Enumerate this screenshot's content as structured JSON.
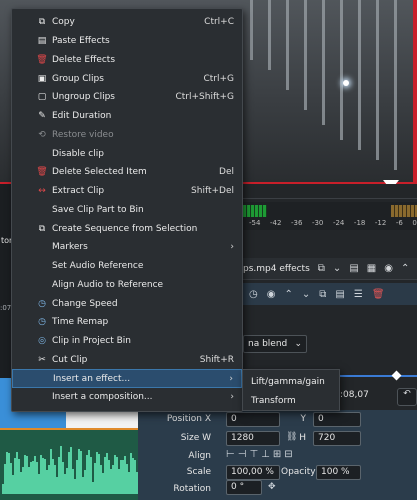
{
  "menu": {
    "items": [
      {
        "icon": "copy-icon",
        "glyph": "⧉",
        "label": "Copy",
        "shortcut": "Ctrl+C"
      },
      {
        "icon": "paste-icon",
        "glyph": "▤",
        "label": "Paste Effects",
        "shortcut": ""
      },
      {
        "icon": "trash-icon",
        "glyph": "🗑",
        "label": "Delete Effects",
        "shortcut": ""
      },
      {
        "icon": "group-icon",
        "glyph": "▣",
        "label": "Group Clips",
        "shortcut": "Ctrl+G"
      },
      {
        "icon": "ungroup-icon",
        "glyph": "▢",
        "label": "Ungroup Clips",
        "shortcut": "Ctrl+Shift+G"
      },
      {
        "icon": "edit-duration-icon",
        "glyph": "✎",
        "label": "Edit Duration",
        "shortcut": ""
      },
      {
        "icon": "restore-icon",
        "glyph": "⟲",
        "label": "Restore video",
        "shortcut": ""
      },
      {
        "icon": "",
        "glyph": "",
        "label": "Disable clip",
        "shortcut": ""
      },
      {
        "icon": "trash-icon",
        "glyph": "🗑",
        "label": "Delete Selected Item",
        "shortcut": "Del"
      },
      {
        "icon": "extract-icon",
        "glyph": "↔",
        "label": "Extract Clip",
        "shortcut": "Shift+Del"
      },
      {
        "icon": "",
        "glyph": "",
        "label": "Save Clip Part to Bin",
        "shortcut": ""
      },
      {
        "icon": "sequence-icon",
        "glyph": "⧉",
        "label": "Create Sequence from Selection",
        "shortcut": ""
      },
      {
        "icon": "",
        "glyph": "",
        "label": "Markers",
        "shortcut": "",
        "submenu": true
      },
      {
        "icon": "",
        "glyph": "",
        "label": "Set Audio Reference",
        "shortcut": ""
      },
      {
        "icon": "",
        "glyph": "",
        "label": "Align Audio to Reference",
        "shortcut": ""
      },
      {
        "icon": "speed-icon",
        "glyph": "◷",
        "label": "Change Speed",
        "shortcut": ""
      },
      {
        "icon": "time-remap-icon",
        "glyph": "◷",
        "label": "Time Remap",
        "shortcut": ""
      },
      {
        "icon": "project-bin-icon",
        "glyph": "◎",
        "label": "Clip in Project Bin",
        "shortcut": ""
      },
      {
        "icon": "scissors-icon",
        "glyph": "✂",
        "label": "Cut Clip",
        "shortcut": "Shift+R"
      },
      {
        "icon": "",
        "glyph": "",
        "label": "Insert an effect...",
        "shortcut": "",
        "submenu": true
      },
      {
        "icon": "",
        "glyph": "",
        "label": "Insert a composition...",
        "shortcut": "",
        "submenu": true
      }
    ]
  },
  "submenu": {
    "items": [
      "Lift/gamma/gain",
      "Transform"
    ]
  },
  "meter": {
    "labels": [
      "-54",
      "-42",
      "-36",
      "-30",
      "-24",
      "-18",
      "-12",
      "-6",
      "0"
    ]
  },
  "effects": {
    "title": "ps.mp4 effects",
    "blend": "na blend",
    "timecode": ":08,07"
  },
  "properties": {
    "position_x_label": "Position X",
    "position_x": "0",
    "position_y_label": "Y",
    "position_y": "0",
    "size_w_label": "Size W",
    "size_w": "1280",
    "size_h_label": "H",
    "size_h": "720",
    "align_label": "Align",
    "scale_label": "Scale",
    "scale": "100,00 %",
    "opacity_label": "Opacity",
    "opacity": "100 %",
    "rotation_label": "Rotation",
    "rotation": "0 °"
  },
  "left_labels": {
    "top": "tor",
    "time": ":07"
  },
  "colors": {
    "accent": "#3b77ab",
    "danger": "#e0484a",
    "menu_bg": "#2a2e32"
  }
}
